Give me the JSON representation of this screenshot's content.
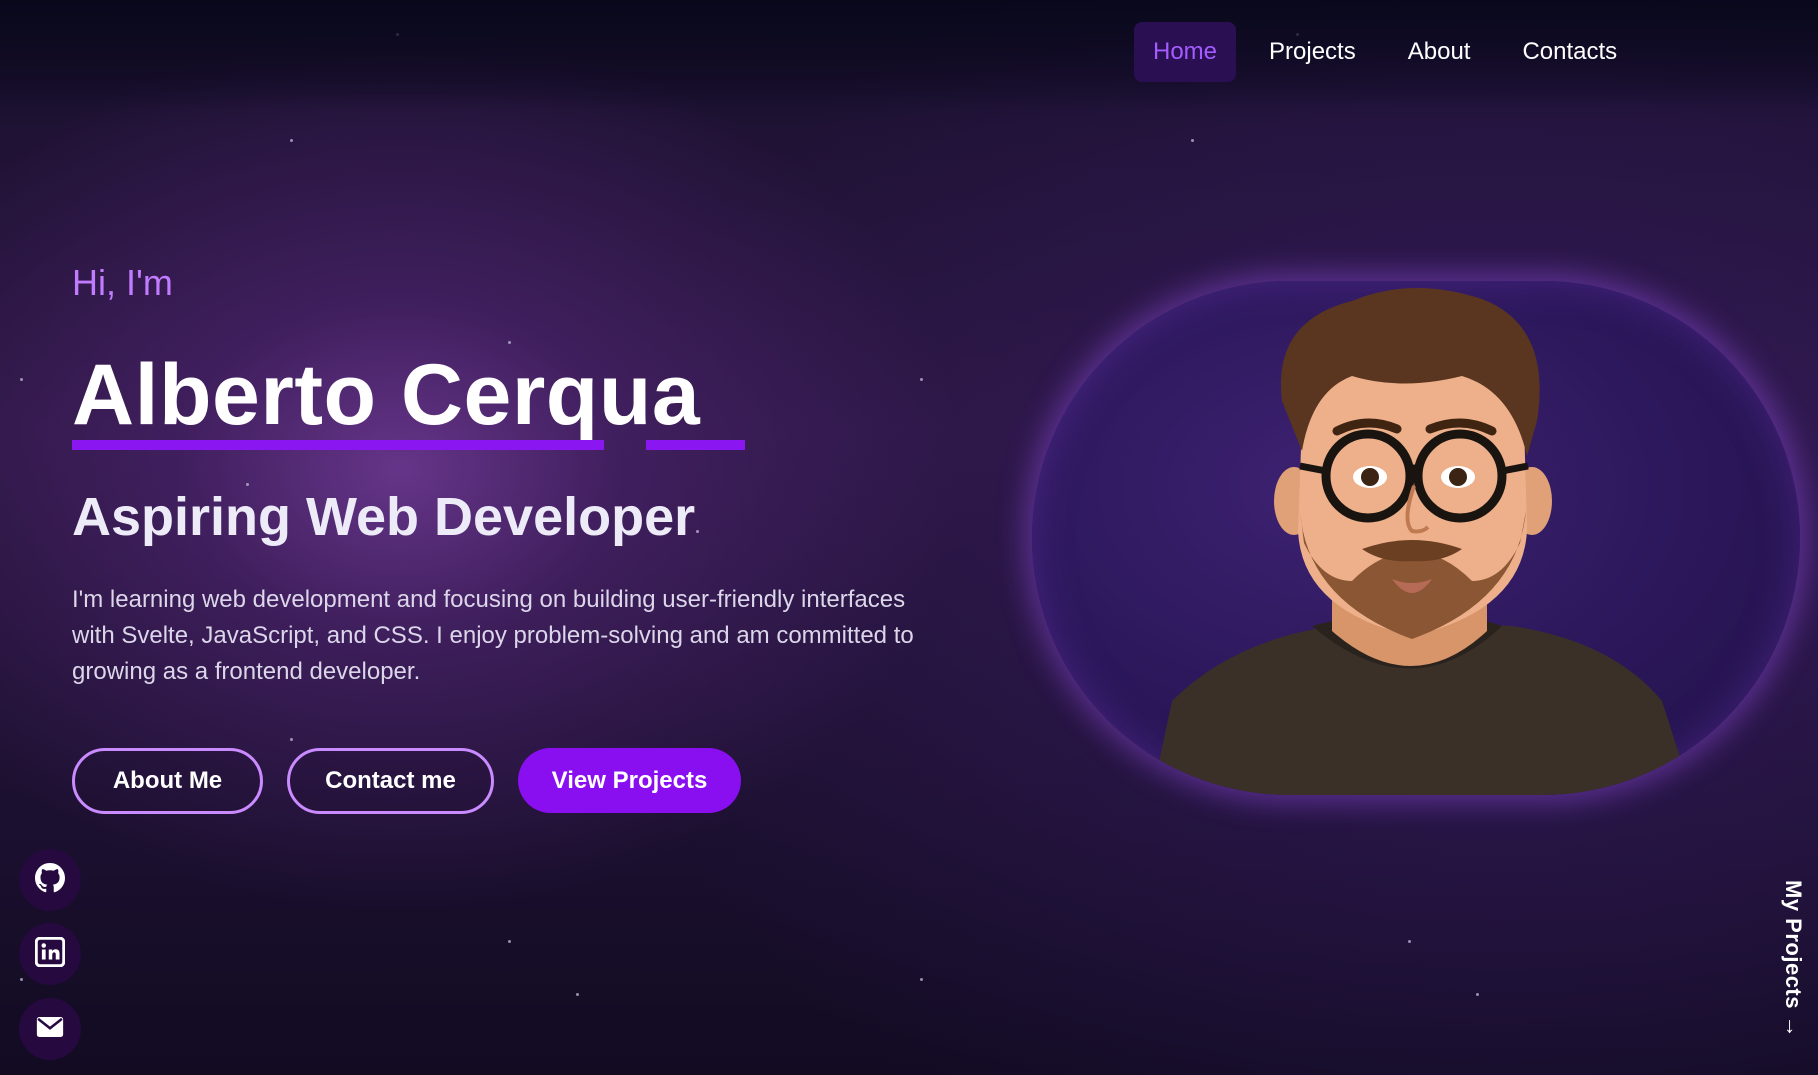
{
  "nav": {
    "items": [
      {
        "label": "Home",
        "active": true
      },
      {
        "label": "Projects"
      },
      {
        "label": "About"
      },
      {
        "label": "Contacts"
      }
    ]
  },
  "hero": {
    "greeting": "Hi, I'm",
    "name": "Alberto Cerqua",
    "role": "Aspiring Web Developer",
    "bio": "I'm learning web development and focusing on building user-friendly interfaces with Svelte, JavaScript, and CSS. I enjoy problem-solving and am committed to growing as a frontend developer.",
    "buttons": {
      "about": "About Me",
      "contact": "Contact me",
      "projects": "View Projects"
    }
  },
  "social": {
    "icons": [
      "github-icon",
      "linkedin-icon",
      "mail-icon"
    ]
  },
  "side_link": {
    "label": "My Projects →"
  },
  "colors": {
    "accent": "#8a0ff0",
    "accent_light": "#c07bff",
    "nav_active_bg": "#2a0f52",
    "background": "#1f1234"
  }
}
